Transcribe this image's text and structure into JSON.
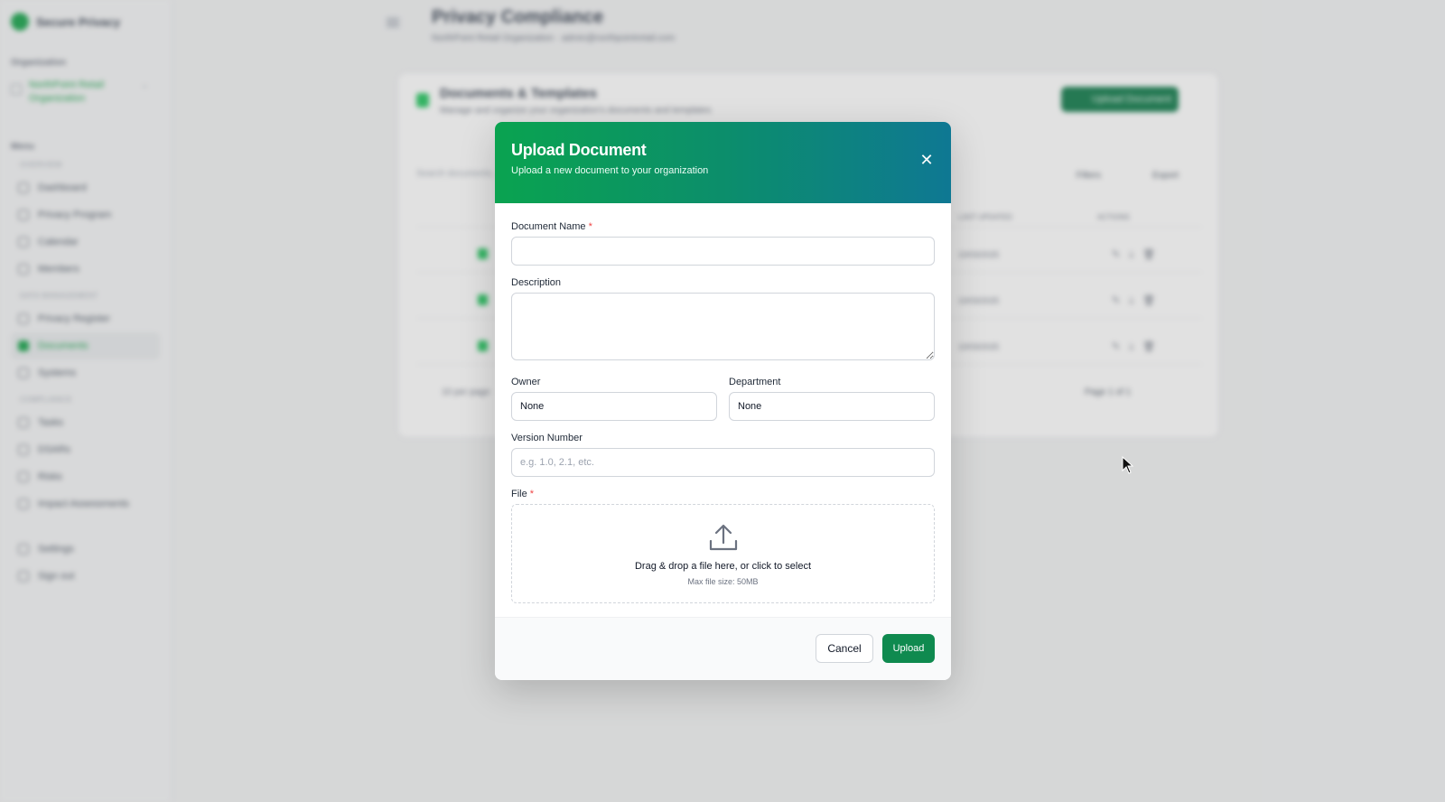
{
  "app": {
    "brand": "Secure Privacy",
    "organization_label": "Organization",
    "organization_name": "NorthPoint Retail Organization",
    "menu_label": "Menu",
    "sections": [
      {
        "label": "OVERVIEW",
        "items": [
          {
            "label": "Dashboard",
            "icon": "dashboard-icon"
          },
          {
            "label": "Privacy Program",
            "icon": "program-icon"
          },
          {
            "label": "Calendar",
            "icon": "calendar-icon"
          },
          {
            "label": "Members",
            "icon": "members-icon"
          }
        ]
      },
      {
        "label": "DATA MANAGEMENT",
        "items": [
          {
            "label": "Privacy Register",
            "icon": "register-icon"
          },
          {
            "label": "Documents",
            "icon": "documents-icon",
            "active": true
          },
          {
            "label": "Systems",
            "icon": "systems-icon"
          }
        ]
      },
      {
        "label": "COMPLIANCE",
        "items": [
          {
            "label": "Tasks",
            "icon": "tasks-icon"
          },
          {
            "label": "DSARs",
            "icon": "dsar-icon"
          },
          {
            "label": "Risks",
            "icon": "risks-icon"
          },
          {
            "label": "Impact Assessments",
            "icon": "assessment-icon"
          }
        ]
      }
    ],
    "footer_items": [
      {
        "label": "Settings",
        "icon": "gear-icon"
      },
      {
        "label": "Sign out",
        "icon": "sign-out-icon"
      }
    ],
    "page_title": "Privacy Compliance",
    "page_subtitle": "NorthPoint Retail Organization · admin@northpointretail.com",
    "card": {
      "title": "Documents & Templates",
      "subtitle": "Manage and organize your organization's documents and templates",
      "upload_button": "Upload Document",
      "search_placeholder": "Search documents...",
      "filters": "Filters",
      "export": "Export",
      "col_last_updated": "LAST UPDATED",
      "col_actions": "ACTIONS",
      "rows": [
        {
          "date": "10/03/2025"
        },
        {
          "date": "10/03/2025"
        },
        {
          "date": "10/03/2025"
        }
      ],
      "page_size": "10 per page",
      "page": "Page 1 of 1"
    }
  },
  "modal": {
    "title": "Upload Document",
    "subtitle": "Upload a new document to your organization",
    "close_icon": "close-icon",
    "fields": {
      "name_label": "Document Name",
      "required_mark": "*",
      "name_value": "",
      "description_label": "Description",
      "description_value": "",
      "owner_label": "Owner",
      "owner_value": "None",
      "department_label": "Department",
      "department_value": "None",
      "version_label": "Version Number",
      "version_placeholder": "e.g. 1.0, 2.1, etc.",
      "file_label": "File"
    },
    "dropzone": {
      "icon": "upload-icon",
      "text": "Drag & drop a file here, or click to select",
      "max_size": "Max file size: 50MB"
    },
    "cancel_label": "Cancel",
    "upload_label": "Upload"
  },
  "colors": {
    "header_gradient_start": "#0aa350",
    "header_gradient_end": "#0e7893",
    "primary": "#0f8a4f"
  }
}
